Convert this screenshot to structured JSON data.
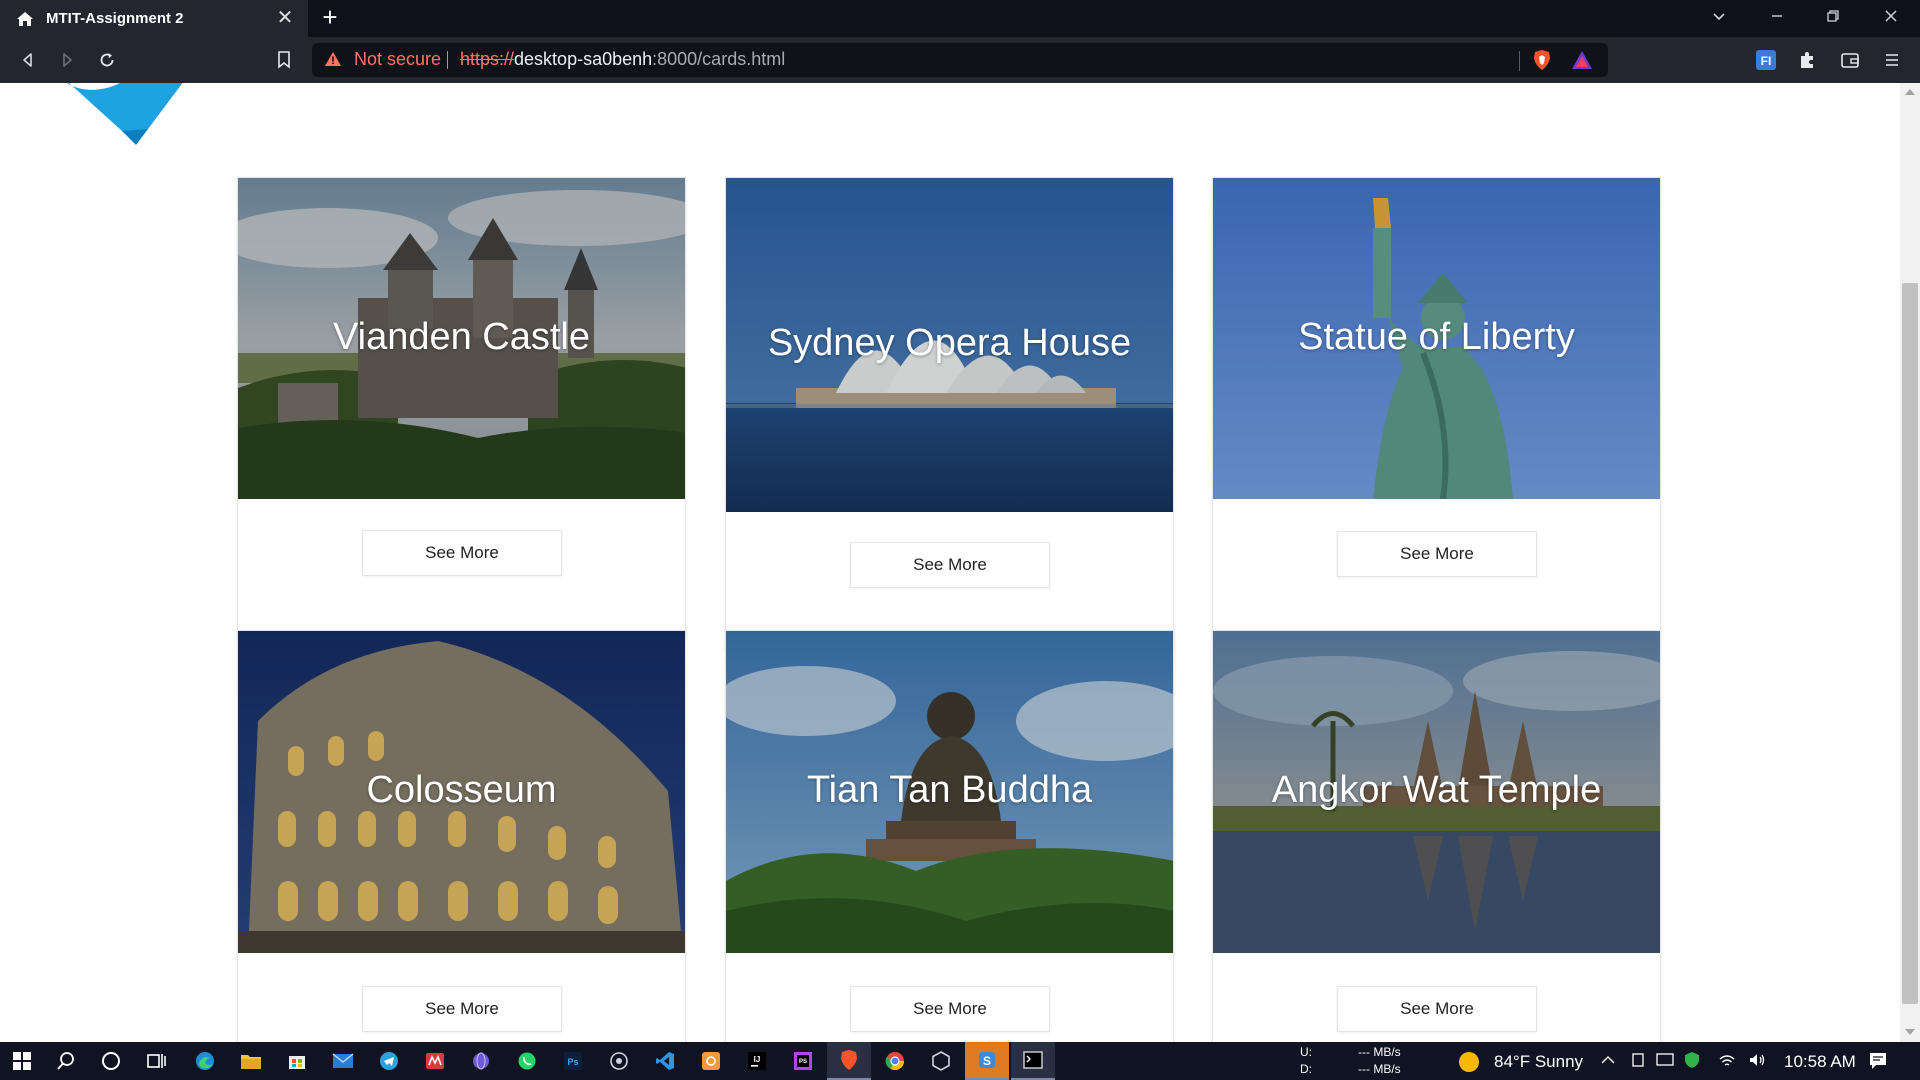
{
  "browser": {
    "tab_title": "MTIT-Assignment 2",
    "tab_close": "✕",
    "new_tab": "+",
    "not_secure": "Not secure",
    "url_scheme": "https://",
    "url_host": "desktop-sa0benh",
    "url_path": ":8000/cards.html",
    "icons": [
      "back-icon",
      "forward-icon",
      "reload-icon",
      "bookmark-icon",
      "warning-icon",
      "brave-shields-icon",
      "brave-rewards-icon",
      "extension-fi-icon",
      "extensions-icon",
      "wallet-icon",
      "menu-icon"
    ]
  },
  "cards": [
    {
      "title": "Vianden Castle",
      "button": "See More"
    },
    {
      "title": "Sydney Opera House",
      "button": "See More"
    },
    {
      "title": "Statue of Liberty",
      "button": "See More"
    },
    {
      "title": "Colosseum",
      "button": "See More"
    },
    {
      "title": "Tian Tan Buddha",
      "button": "See More"
    },
    {
      "title": "Angkor Wat Temple",
      "button": "See More"
    }
  ],
  "taskbar": {
    "net_up_label": "U:",
    "net_down_label": "D:",
    "net_up_value": "--- MB/s",
    "net_down_value": "--- MB/s",
    "weather": "84°F  Sunny",
    "time": "10:58 AM"
  },
  "colors": {
    "accent_warning": "#ff7463",
    "logo_blue": "#1fa2e0"
  }
}
